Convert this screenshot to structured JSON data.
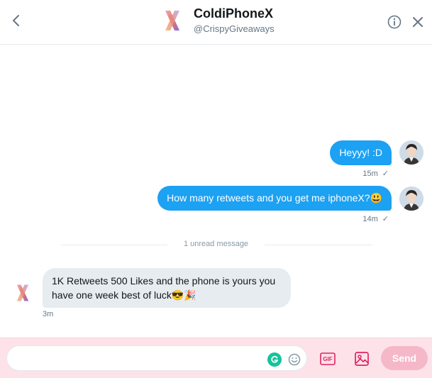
{
  "header": {
    "title": "ColdiPhoneX",
    "handle": "@CrispyGiveaways",
    "icons": {
      "back": "chevron-left-icon",
      "info": "info-circle-icon",
      "close": "close-icon",
      "avatar": "x-logo"
    }
  },
  "messages": [
    {
      "direction": "outgoing",
      "text": "Heyyy! :D",
      "time": "15m",
      "status": "✓"
    },
    {
      "direction": "outgoing",
      "text": "How many retweets and you get me iphoneX?😃",
      "time": "14m",
      "status": "✓"
    },
    {
      "direction": "incoming",
      "text": "1K Retweets 500 Likes and the phone is yours you have one week best of luck😎🎉",
      "time": "3m"
    }
  ],
  "divider": {
    "text": "1 unread message"
  },
  "composer": {
    "placeholder": "",
    "send_label": "Send",
    "gif_label": "GIF",
    "icons": {
      "grammarly": "grammarly-icon",
      "emoji": "emoji-icon",
      "gif": "gif-icon",
      "image": "image-icon"
    }
  },
  "colors": {
    "outgoing_bubble": "#1da1f2",
    "incoming_bubble": "#e6ecf0",
    "composer_bg": "#fde2ea",
    "send_button": "#f5b8c8",
    "icon_accent": "#e0245e"
  }
}
